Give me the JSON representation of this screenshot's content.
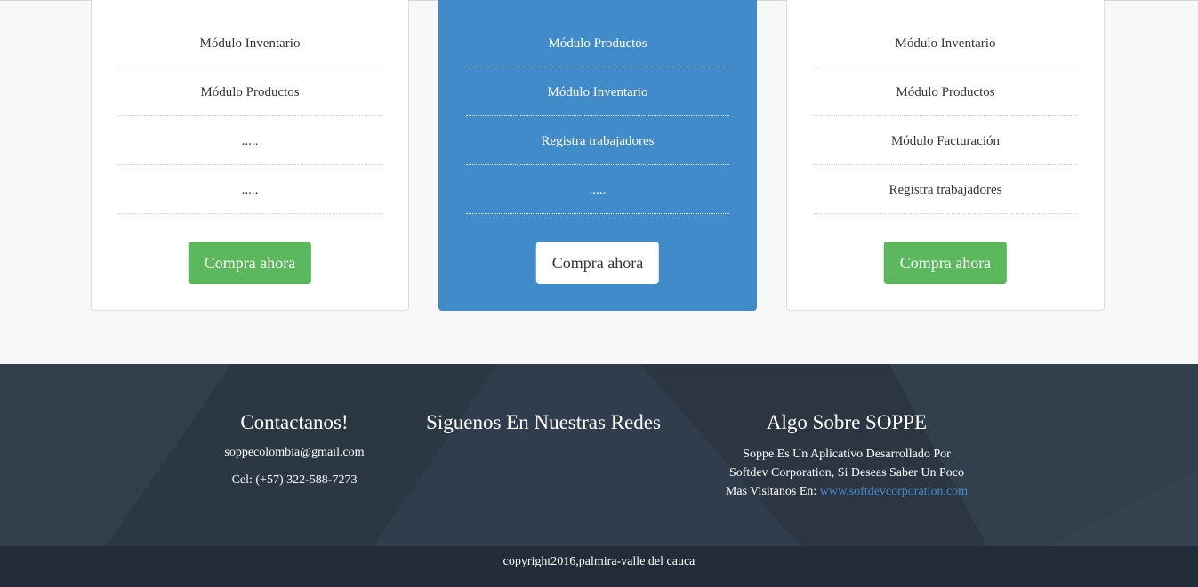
{
  "plans": [
    {
      "features": [
        "Módulo Inventario",
        "Módulo Productos",
        ".....",
        "....."
      ],
      "button_label": "Compra ahora"
    },
    {
      "features": [
        "Módulo Productos",
        "Módulo Inventario",
        "Registra trabajadores",
        "....."
      ],
      "button_label": "Compra ahora"
    },
    {
      "features": [
        "Módulo Inventario",
        "Módulo Productos",
        "Módulo Facturación",
        "Registra trabajadores"
      ],
      "button_label": "Compra ahora"
    }
  ],
  "footer": {
    "contact": {
      "title": "Contactanos!",
      "email": "soppecolombia@gmail.com",
      "phone": "Cel: (+57) 322-588-7273"
    },
    "social": {
      "title": "Siguenos En Nuestras Redes"
    },
    "about": {
      "title": "Algo Sobre SOPPE",
      "text_line1": "Soppe Es Un Aplicativo Desarrollado Por",
      "text_line2": "Softdev Corporation, Si Deseas Saber Un Poco",
      "text_line3": "Mas Visitanos En:",
      "link": "www.softdevcorporation.com"
    },
    "copyright": "copyright2016,palmira-valle del cauca"
  },
  "colors": {
    "accent": "#428bca",
    "buy_button": "#5cb85c",
    "footer_bg": "#2f3a47",
    "bottom_bar": "#222d39"
  }
}
